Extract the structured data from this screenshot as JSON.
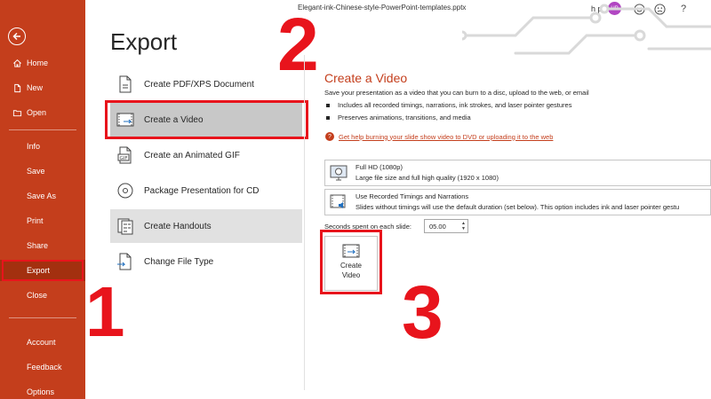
{
  "window": {
    "doc_title": "Elegant-ink-Chinese-style-PowerPoint-templates.pptx",
    "user_initials_text": "h p",
    "avatar_initials": "HP",
    "help_glyph": "?"
  },
  "sidebar": {
    "items": [
      {
        "label": "Home",
        "icon": "home-icon"
      },
      {
        "label": "New",
        "icon": "new-document-icon"
      },
      {
        "label": "Open",
        "icon": "folder-icon"
      },
      {
        "label": "Info"
      },
      {
        "label": "Save"
      },
      {
        "label": "Save As"
      },
      {
        "label": "Print"
      },
      {
        "label": "Share"
      },
      {
        "label": "Export"
      },
      {
        "label": "Close"
      },
      {
        "label": "Account"
      },
      {
        "label": "Feedback"
      },
      {
        "label": "Options"
      }
    ]
  },
  "main": {
    "heading": "Export",
    "options": [
      {
        "label": "Create PDF/XPS Document",
        "icon": "pdf-icon"
      },
      {
        "label": "Create a Video",
        "icon": "video-icon"
      },
      {
        "label": "Create an Animated GIF",
        "icon": "gif-icon"
      },
      {
        "label": "Package Presentation for CD",
        "icon": "cd-icon"
      },
      {
        "label": "Create Handouts",
        "icon": "handouts-icon"
      },
      {
        "label": "Change File Type",
        "icon": "change-file-type-icon"
      }
    ]
  },
  "right_panel": {
    "title": "Create a Video",
    "description": "Save your presentation as a video that you can burn to a disc, upload to the web, or email",
    "bullets": [
      "Includes all recorded timings, narrations, ink strokes, and laser pointer gestures",
      "Preserves animations, transitions, and media"
    ],
    "help_link": "Get help burning your slide show video to DVD or uploading it to the web",
    "quality_dropdown": {
      "title": "Full HD (1080p)",
      "subtitle": "Large file size and full high quality (1920 x 1080)"
    },
    "timings_dropdown": {
      "title": "Use Recorded Timings and Narrations",
      "subtitle": "Slides without timings will use the default duration (set below). This option includes ink and laser pointer gestu"
    },
    "seconds_label": "Seconds spent on each slide:",
    "seconds_value": "05.00",
    "create_button_line1": "Create",
    "create_button_line2": "Video"
  },
  "annotations": {
    "step1": "1",
    "step2": "2",
    "step3": "3",
    "highlight_color": "#e8141c"
  },
  "colors": {
    "accent": "#c43e1c",
    "selected_bg": "#c8c8c8",
    "hover_bg": "#e1e1e1"
  }
}
